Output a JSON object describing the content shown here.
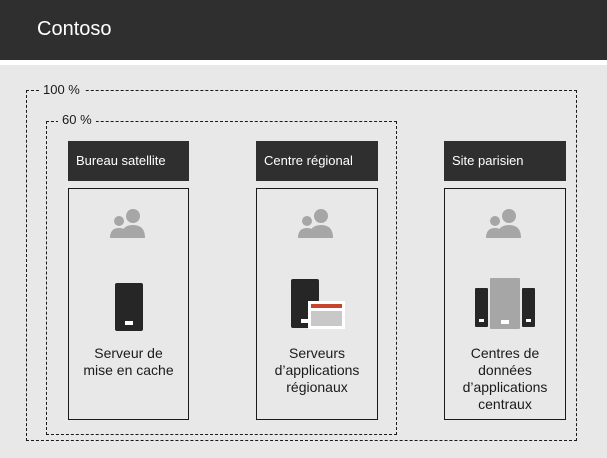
{
  "header": {
    "title": "Contoso"
  },
  "scopes": {
    "full_label": "100 %",
    "partial_label": "60 %"
  },
  "sites": [
    {
      "name": "Bureau satellite",
      "caption_lines": [
        "Serveur de",
        "mise en cache"
      ]
    },
    {
      "name": "Centre régional",
      "caption_lines": [
        "Serveurs",
        "d’applications",
        "régionaux"
      ]
    },
    {
      "name": "Site parisien",
      "caption_lines": [
        "Centres de",
        "données",
        "d’applications",
        "centraux"
      ]
    }
  ],
  "icons": {
    "users": "users-icon",
    "phone_server": "phone-server-icon",
    "server_window": "server-window-icon",
    "server_cluster": "server-cluster-icon"
  },
  "colors": {
    "dark": "#2f2f2f",
    "background": "#e8e8e8",
    "icon_gray": "#a6a6a6",
    "device_dark": "#262626",
    "accent_red": "#c8432b"
  }
}
